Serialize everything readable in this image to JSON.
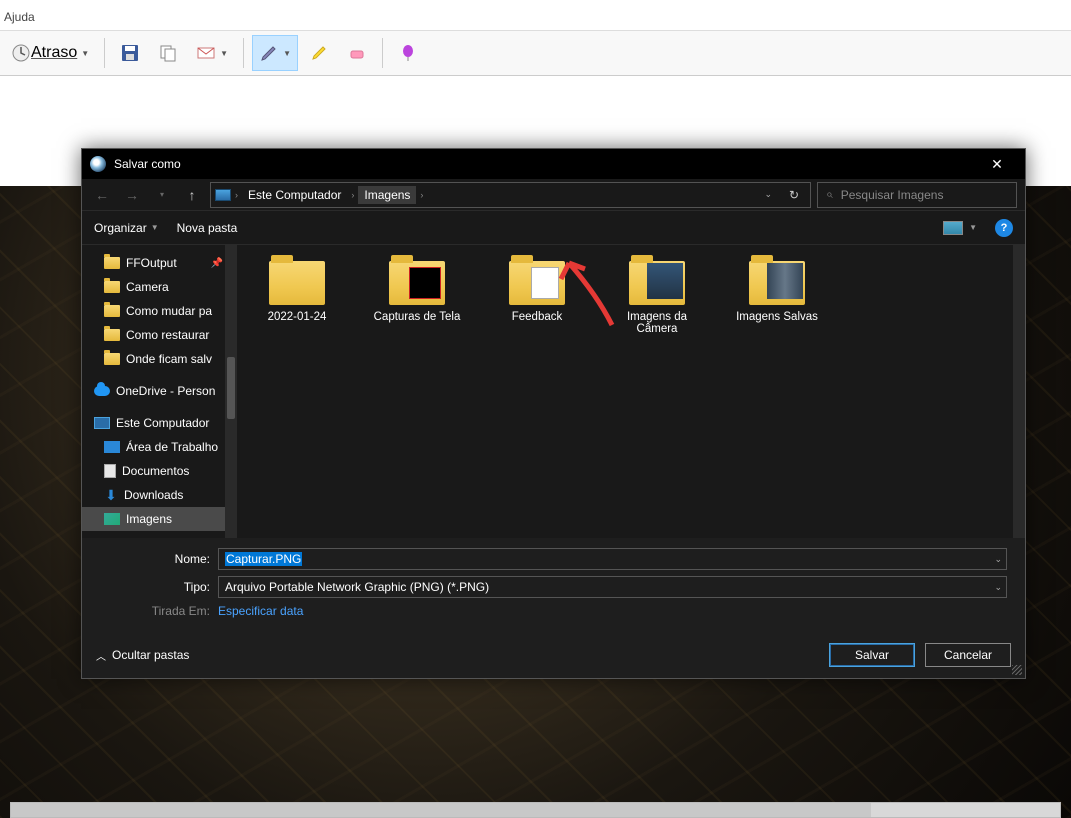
{
  "menu": {
    "ajuda": "Ajuda"
  },
  "toolbar": {
    "atraso": "Atraso"
  },
  "dialog": {
    "title": "Salvar como",
    "breadcrumb": {
      "root": "Este Computador",
      "current": "Imagens"
    },
    "search_placeholder": "Pesquisar Imagens",
    "organize": "Organizar",
    "new_folder": "Nova pasta",
    "sidebar": {
      "ffoutput": "FFOutput",
      "camera": "Camera",
      "como_mudar": "Como mudar pa",
      "como_restaurar": "Como restaurar",
      "onde_ficam": "Onde ficam salv",
      "onedrive": "OneDrive - Person",
      "este_computador": "Este Computador",
      "area_trabalho": "Área de Trabalho",
      "documentos": "Documentos",
      "downloads": "Downloads",
      "imagens": "Imagens"
    },
    "folders": {
      "f1": "2022-01-24",
      "f2": "Capturas de Tela",
      "f3": "Feedback",
      "f4": "Imagens da Câmera",
      "f5": "Imagens Salvas"
    },
    "form": {
      "nome_label": "Nome:",
      "nome_value": "Capturar.PNG",
      "tipo_label": "Tipo:",
      "tipo_value": "Arquivo Portable Network Graphic (PNG) (*.PNG)",
      "tirada_label": "Tirada Em:",
      "tirada_link": "Especificar data"
    },
    "hide_folders": "Ocultar pastas",
    "save": "Salvar",
    "cancel": "Cancelar"
  }
}
